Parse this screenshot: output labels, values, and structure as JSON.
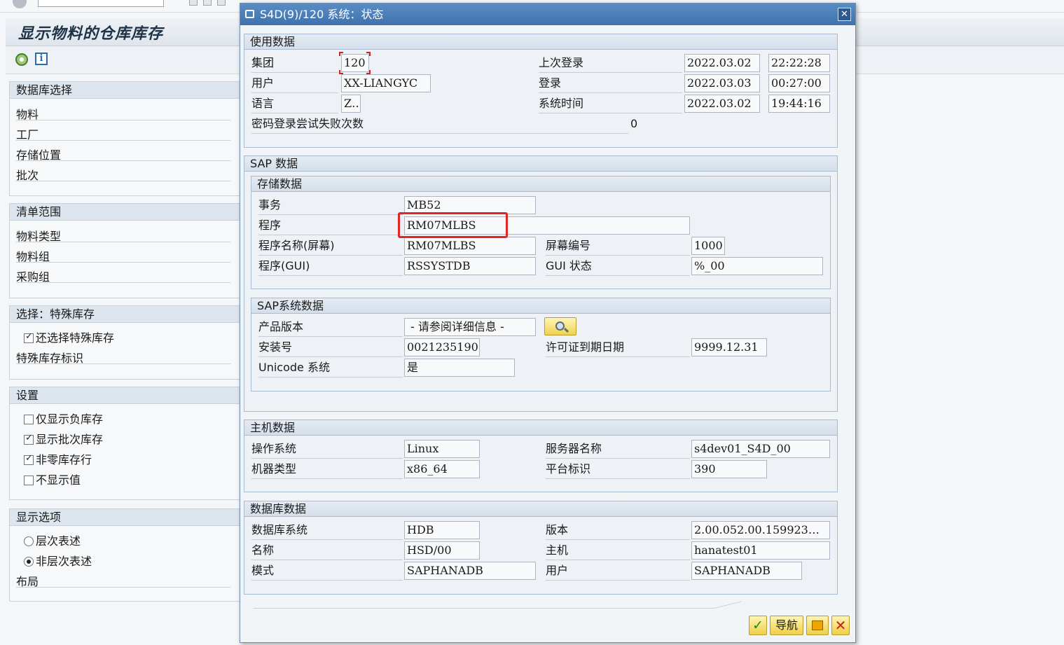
{
  "background": {
    "title": "显示物料的仓库库存",
    "groups": {
      "db_select": {
        "header": "数据库选择",
        "items": [
          "物料",
          "工厂",
          "存储位置",
          "批次"
        ]
      },
      "list_scope": {
        "header": "清单范围",
        "items": [
          "物料类型",
          "物料组",
          "采购组"
        ]
      },
      "special_stock": {
        "header": "选择：特殊库存",
        "items": [
          {
            "label": "还选择特殊库存",
            "checked": true
          },
          {
            "label": "特殊库存标识"
          }
        ]
      },
      "settings": {
        "header": "设置",
        "items": [
          {
            "label": "仅显示负库存",
            "checked": false
          },
          {
            "label": "显示批次库存",
            "checked": true
          },
          {
            "label": "非零库存行",
            "checked": true
          },
          {
            "label": "不显示值",
            "checked": false
          }
        ]
      },
      "display_options": {
        "header": "显示选项",
        "items": [
          {
            "label": "层次表述",
            "selected": false
          },
          {
            "label": "非层次表述",
            "selected": true
          },
          {
            "label": "布局"
          }
        ]
      }
    }
  },
  "dialog": {
    "title": "S4D(9)/120 系统：状态",
    "usage": {
      "header": "使用数据",
      "client_label": "集团",
      "client": "120",
      "user_label": "用户",
      "user": "XX-LIANGYC",
      "language_label": "语言",
      "language": "ZH",
      "pw_fail_label": "密码登录尝试失败次数",
      "pw_fail": "0",
      "last_login_label": "上次登录",
      "last_login_date": "2022.03.02",
      "last_login_time": "22:22:28",
      "login_label": "登录",
      "login_date": "2022.03.03",
      "login_time": "00:27:00",
      "system_time_label": "系统时间",
      "system_date": "2022.03.02",
      "system_time": "19:44:16"
    },
    "sap_data": {
      "header": "SAP 数据",
      "repository": {
        "header": "存储数据",
        "transaction_label": "事务",
        "transaction": "MB52",
        "program_label": "程序",
        "program": "RM07MLBS",
        "program_screen_label": "程序名称(屏幕)",
        "program_screen": "RM07MLBS",
        "screen_no_label": "屏幕编号",
        "screen_no": "1000",
        "program_gui_label": "程序(GUI)",
        "program_gui": "RSSYSTDB",
        "gui_status_label": "GUI 状态",
        "gui_status": "%_00"
      },
      "system": {
        "header": "SAP系统数据",
        "product_version_label": "产品版本",
        "product_version": "- 请参阅详细信息 -",
        "install_no_label": "安装号",
        "install_no": "0021235190",
        "license_expiry_label": "许可证到期日期",
        "license_expiry": "9999.12.31",
        "unicode_label": "Unicode 系统",
        "unicode": "是"
      }
    },
    "host": {
      "header": "主机数据",
      "os_label": "操作系统",
      "os": "Linux",
      "server_label": "服务器名称",
      "server": "s4dev01_S4D_00",
      "machine_label": "机器类型",
      "machine": "x86_64",
      "platform_label": "平台标识",
      "platform": "390"
    },
    "database": {
      "header": "数据库数据",
      "system_label": "数据库系统",
      "system": "HDB",
      "version_label": "版本",
      "version": "2.00.052.00.159923…",
      "name_label": "名称",
      "name": "HSD/00",
      "host_label": "主机",
      "host": "hanatest01",
      "schema_label": "模式",
      "schema": "SAPHANADB",
      "user_label": "用户",
      "user": "SAPHANADB"
    },
    "footer": {
      "navigate_label": "导航"
    }
  }
}
